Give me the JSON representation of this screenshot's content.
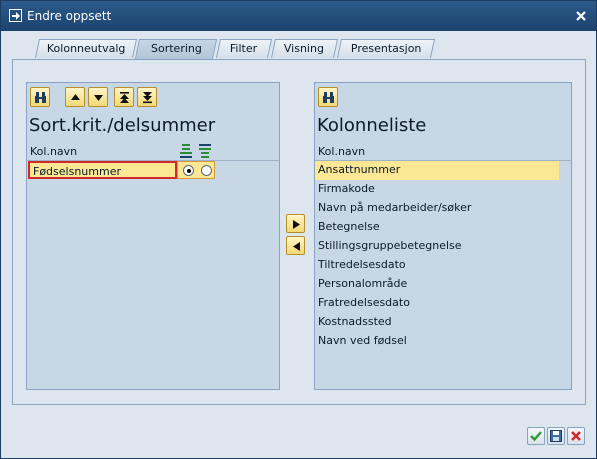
{
  "window": {
    "title": "Endre oppsett"
  },
  "tabs": [
    {
      "label": "Kolonneutvalg"
    },
    {
      "label": "Sortering"
    },
    {
      "label": "Filter"
    },
    {
      "label": "Visning"
    },
    {
      "label": "Presentasjon"
    }
  ],
  "active_tab": "Sortering",
  "left_panel": {
    "title": "Sort.krit./delsummer",
    "column_header": "Kol.navn",
    "rows": [
      {
        "name": "Fødselsnummer",
        "ascending_selected": true,
        "descending_selected": false
      }
    ],
    "toolbar": [
      {
        "icon": "binoculars-icon"
      },
      {
        "icon": "arrow-up-icon"
      },
      {
        "icon": "arrow-down-icon"
      },
      {
        "icon": "arrow-top-icon"
      },
      {
        "icon": "arrow-bottom-icon"
      }
    ],
    "header_icons": [
      "sort-ascending-icon",
      "sort-descending-icon"
    ]
  },
  "transfer_buttons": [
    {
      "icon": "move-right-icon"
    },
    {
      "icon": "move-left-icon"
    }
  ],
  "right_panel": {
    "title": "Kolonneliste",
    "column_header": "Kol.navn",
    "toolbar": [
      {
        "icon": "binoculars-icon"
      }
    ],
    "items": [
      "Ansattnummer",
      "Firmakode",
      "Navn på medarbeider/søker",
      "Betegnelse",
      "Stillingsgruppebetegnelse",
      "Tiltredelsesdato",
      "Personalområde",
      "Fratredelsesdato",
      "Kostnadssted",
      "Navn ved fødsel"
    ],
    "selected_index": 0
  },
  "footer_buttons": [
    {
      "icon": "checkmark-icon"
    },
    {
      "icon": "save-icon"
    },
    {
      "icon": "cancel-icon"
    }
  ],
  "colors": {
    "titlebar": "#1b4370",
    "selection": "#fce795",
    "panel": "#c8d7e6",
    "error_border": "#d02a2a"
  }
}
